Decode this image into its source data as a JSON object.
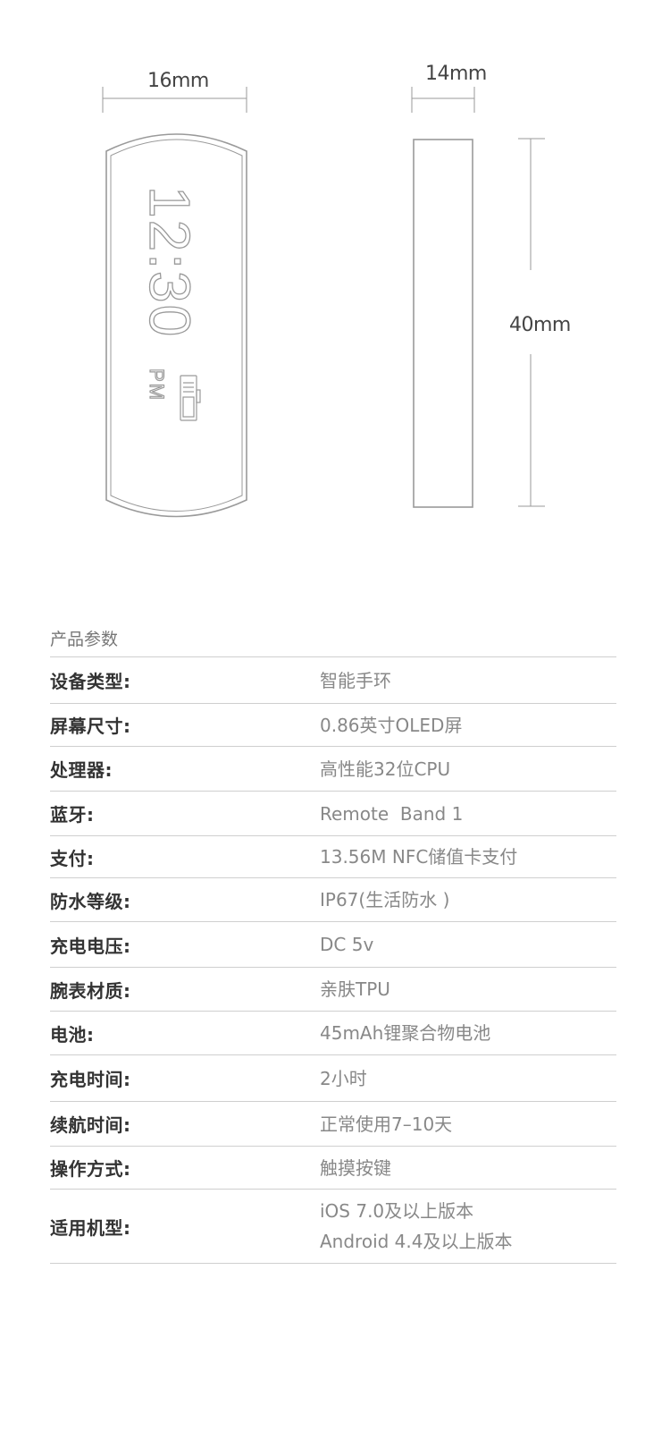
{
  "dimensions": {
    "width": "16mm",
    "depth": "14mm",
    "height": "40mm"
  },
  "device_display": {
    "time": "12:30",
    "meridiem": "PM"
  },
  "icons": {
    "battery": "battery-icon"
  },
  "specs": {
    "title": "产品参数",
    "rows": [
      {
        "label": "设备类型:",
        "value": "智能手环"
      },
      {
        "label": "屏幕尺寸:",
        "value": "0.86英寸OLED屏"
      },
      {
        "label": "处理器:",
        "value": "高性能32位CPU"
      },
      {
        "label": "蓝牙:",
        "value": "Remote  Band 1"
      },
      {
        "label": "支付:",
        "value": "13.56M NFC储值卡支付"
      },
      {
        "label": "防水等级:",
        "value": "IP67(生活防水 )"
      },
      {
        "label": "充电电压:",
        "value": "DC 5v"
      },
      {
        "label": "腕表材质:",
        "value": "亲肤TPU"
      },
      {
        "label": "电池:",
        "value": "45mAh锂聚合物电池"
      },
      {
        "label": "充电时间:",
        "value": "2小时"
      },
      {
        "label": "续航时间:",
        "value": "正常使用7–10天"
      },
      {
        "label": "操作方式:",
        "value": "触摸按键"
      },
      {
        "label": "适用机型:",
        "value": "iOS 7.0及以上版本",
        "value2": "Android 4.4及以上版本"
      }
    ]
  },
  "colors": {
    "line": "#9a9a9a",
    "divider": "#cfcfcf",
    "label": "#333333",
    "value": "#888888"
  }
}
